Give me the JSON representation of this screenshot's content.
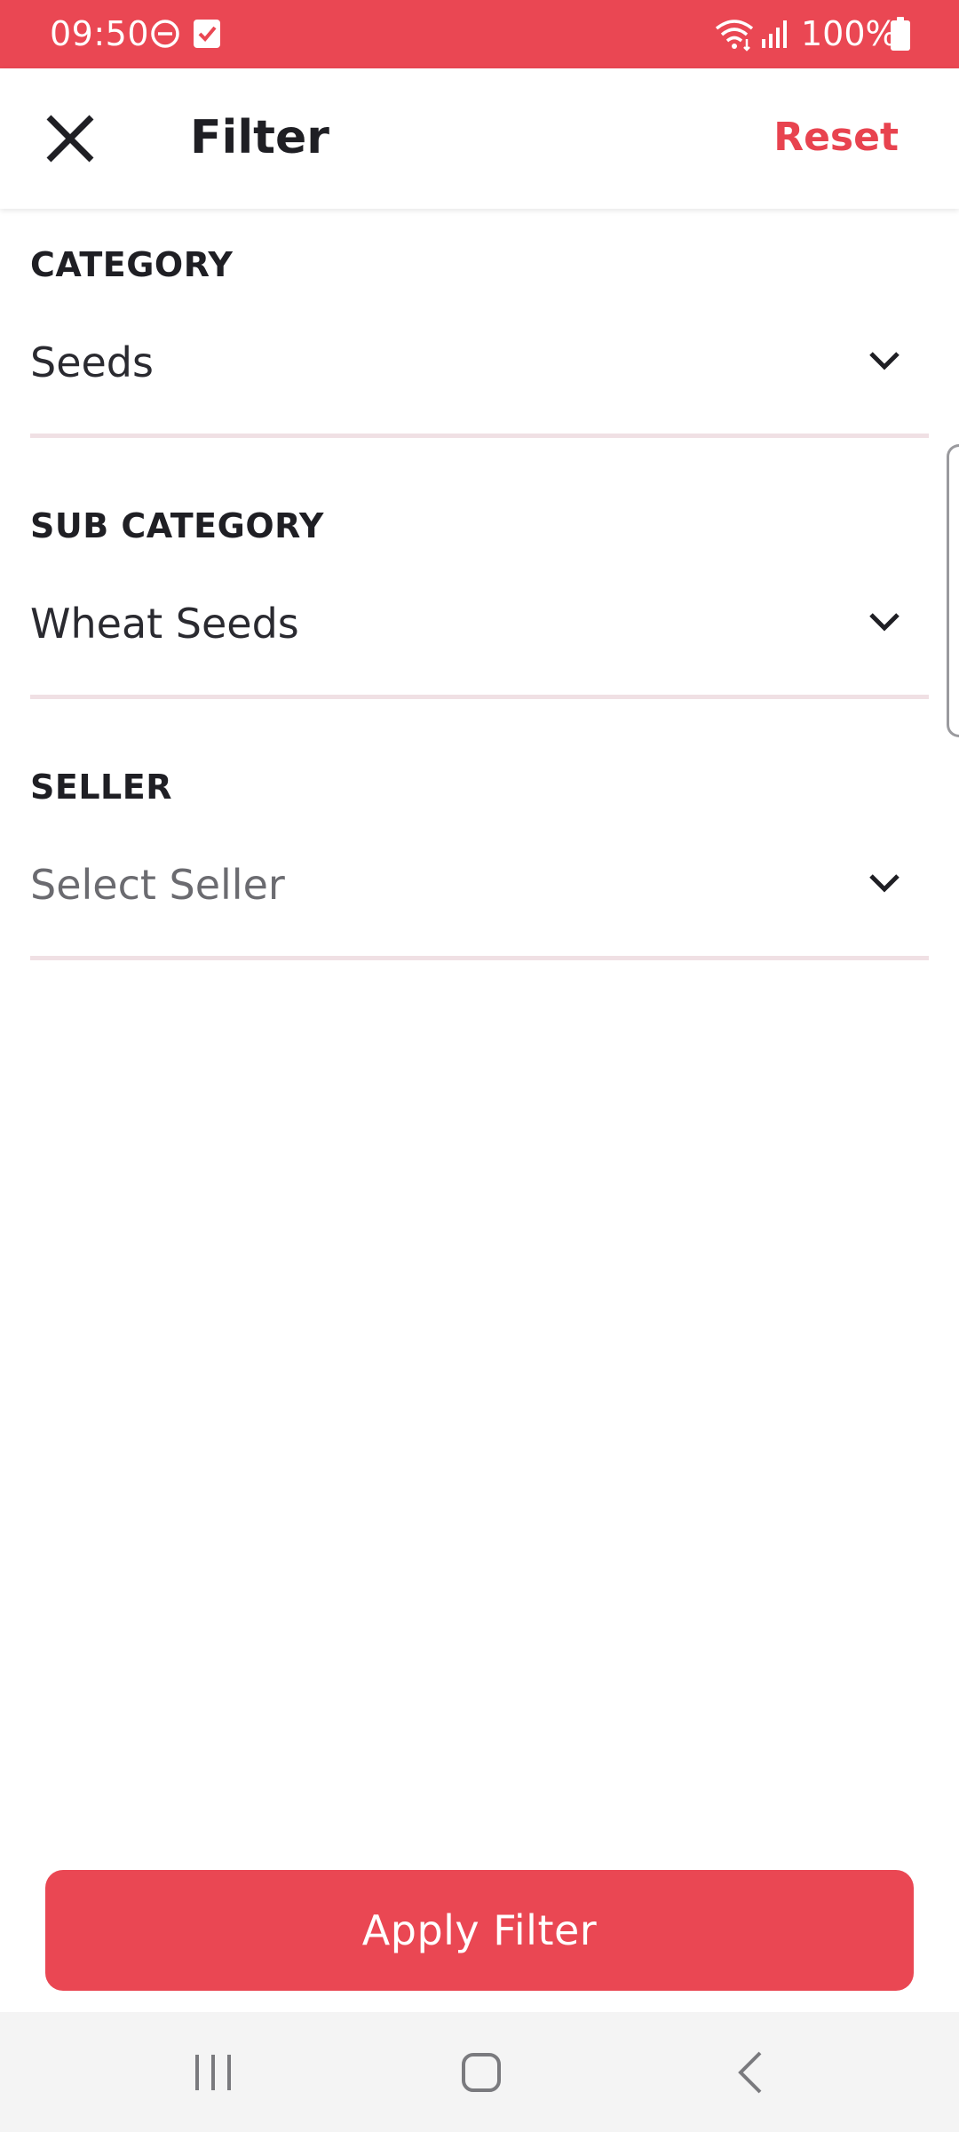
{
  "status_bar": {
    "time": "09:50",
    "battery": "100%",
    "color": "#ea4753",
    "icons": [
      "do-not-disturb-icon",
      "checkbox-notification-icon",
      "wifi-icon",
      "signal-icon",
      "battery-icon"
    ]
  },
  "header": {
    "title": "Filter",
    "reset_label": "Reset",
    "close_icon": "close-icon"
  },
  "filters": {
    "category": {
      "label": "CATEGORY",
      "value": "Seeds"
    },
    "sub_category": {
      "label": "SUB CATEGORY",
      "value": "Wheat Seeds"
    },
    "seller": {
      "label": "SELLER",
      "placeholder": "Select Seller"
    }
  },
  "apply_button": {
    "label": "Apply Filter"
  },
  "nav_bar": {
    "icons": [
      "recent-apps-icon",
      "home-icon",
      "back-icon"
    ]
  },
  "colors": {
    "accent": "#ea4753",
    "reset_text": "#e8434f",
    "underline": "#f0e0e4"
  }
}
